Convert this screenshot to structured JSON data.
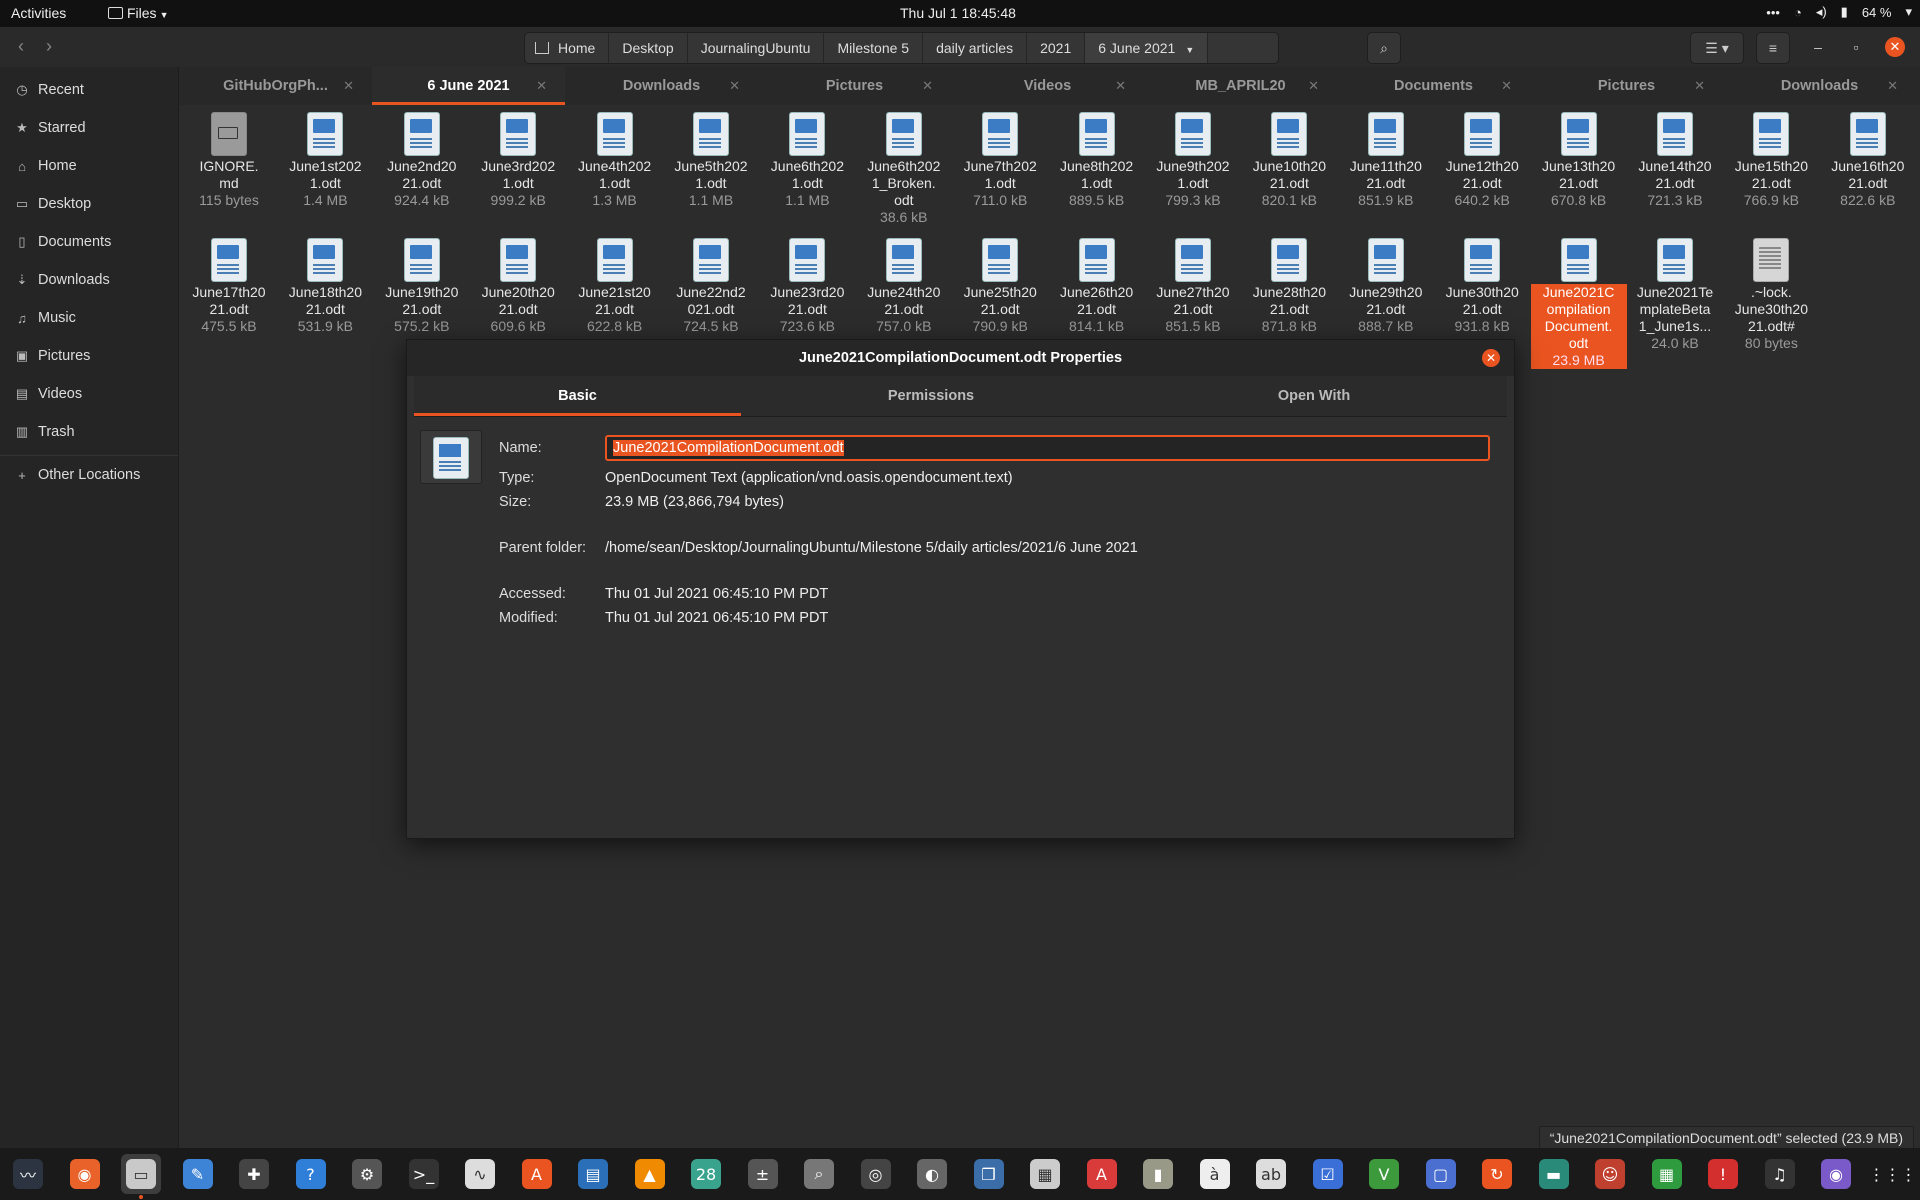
{
  "topbar": {
    "activities": "Activities",
    "app_menu": "Files",
    "clock": "Thu Jul 1  18:45:48",
    "battery": "64 %"
  },
  "pathbar": {
    "crumbs": [
      "Home",
      "Desktop",
      "JournalingUbuntu",
      "Milestone 5",
      "daily articles",
      "2021",
      "6 June 2021"
    ]
  },
  "sidebar": {
    "items": [
      {
        "label": "Recent",
        "icon": "clock-icon"
      },
      {
        "label": "Starred",
        "icon": "star-icon"
      },
      {
        "label": "Home",
        "icon": "home-icon"
      },
      {
        "label": "Desktop",
        "icon": "desktop-icon"
      },
      {
        "label": "Documents",
        "icon": "documents-icon"
      },
      {
        "label": "Downloads",
        "icon": "downloads-icon"
      },
      {
        "label": "Music",
        "icon": "music-icon"
      },
      {
        "label": "Pictures",
        "icon": "pictures-icon"
      },
      {
        "label": "Videos",
        "icon": "videos-icon"
      },
      {
        "label": "Trash",
        "icon": "trash-icon"
      }
    ],
    "other": "Other Locations"
  },
  "tabs": [
    "GitHubOrgPh...",
    "6 June 2021",
    "Downloads",
    "Pictures",
    "Videos",
    "MB_APRIL20",
    "Documents",
    "Pictures",
    "Downloads"
  ],
  "files": [
    {
      "name": "IGNORE.\nmd",
      "size": "115 bytes",
      "kind": "md"
    },
    {
      "name": "June1st202\n1.odt",
      "size": "1.4 MB"
    },
    {
      "name": "June2nd20\n21.odt",
      "size": "924.4 kB"
    },
    {
      "name": "June3rd202\n1.odt",
      "size": "999.2 kB"
    },
    {
      "name": "June4th202\n1.odt",
      "size": "1.3 MB"
    },
    {
      "name": "June5th202\n1.odt",
      "size": "1.1 MB"
    },
    {
      "name": "June6th202\n1.odt",
      "size": "1.1 MB"
    },
    {
      "name": "June6th202\n1_Broken.\nodt",
      "size": "38.6 kB"
    },
    {
      "name": "June7th202\n1.odt",
      "size": "711.0 kB"
    },
    {
      "name": "June8th202\n1.odt",
      "size": "889.5 kB"
    },
    {
      "name": "June9th202\n1.odt",
      "size": "799.3 kB"
    },
    {
      "name": "June10th20\n21.odt",
      "size": "820.1 kB"
    },
    {
      "name": "June11th20\n21.odt",
      "size": "851.9 kB"
    },
    {
      "name": "June12th20\n21.odt",
      "size": "640.2 kB"
    },
    {
      "name": "June13th20\n21.odt",
      "size": "670.8 kB"
    },
    {
      "name": "June14th20\n21.odt",
      "size": "721.3 kB"
    },
    {
      "name": "June15th20\n21.odt",
      "size": "766.9 kB"
    },
    {
      "name": "June16th20\n21.odt",
      "size": "822.6 kB"
    },
    {
      "name": "June17th20\n21.odt",
      "size": "475.5 kB"
    },
    {
      "name": "June18th20\n21.odt",
      "size": "531.9 kB"
    },
    {
      "name": "June19th20\n21.odt",
      "size": "575.2 kB"
    },
    {
      "name": "June20th20\n21.odt",
      "size": "609.6 kB"
    },
    {
      "name": "June21st20\n21.odt",
      "size": "622.8 kB"
    },
    {
      "name": "June22nd2\n021.odt",
      "size": "724.5 kB"
    },
    {
      "name": "June23rd20\n21.odt",
      "size": "723.6 kB"
    },
    {
      "name": "June24th20\n21.odt",
      "size": "757.0 kB"
    },
    {
      "name": "June25th20\n21.odt",
      "size": "790.9 kB"
    },
    {
      "name": "June26th20\n21.odt",
      "size": "814.1 kB"
    },
    {
      "name": "June27th20\n21.odt",
      "size": "851.5 kB"
    },
    {
      "name": "June28th20\n21.odt",
      "size": "871.8 kB"
    },
    {
      "name": "June29th20\n21.odt",
      "size": "888.7 kB"
    },
    {
      "name": "June30th20\n21.odt",
      "size": "931.8 kB"
    },
    {
      "name": "June2021C\nompilation\nDocument.\nodt",
      "size": "23.9 MB",
      "selected": true
    },
    {
      "name": "June2021Te\nmplateBeta\n1_June1s...",
      "size": "24.0 kB"
    },
    {
      "name": ".~lock.\nJune30th20\n21.odt#",
      "size": "80 bytes",
      "kind": "txt"
    }
  ],
  "dialog": {
    "title": "June2021CompilationDocument.odt Properties",
    "tabs": [
      "Basic",
      "Permissions",
      "Open With"
    ],
    "name_label": "Name:",
    "name_value": "June2021CompilationDocument.odt",
    "type_label": "Type:",
    "type_value": "OpenDocument Text (application/vnd.oasis.opendocument.text)",
    "size_label": "Size:",
    "size_value": "23.9 MB (23,866,794 bytes)",
    "parent_label": "Parent folder:",
    "parent_value": "/home/sean/Desktop/JournalingUbuntu/Milestone 5/daily articles/2021/6 June 2021",
    "accessed_label": "Accessed:",
    "accessed_value": "Thu 01 Jul 2021 06:45:10 PM PDT",
    "modified_label": "Modified:",
    "modified_value": "Thu 01 Jul 2021 06:45:10 PM PDT"
  },
  "status": "“June2021CompilationDocument.odt” selected  (23.9 MB)",
  "dock": [
    {
      "icon": "system-monitor-icon",
      "glyph": "〰",
      "bg": "#2b3440"
    },
    {
      "icon": "firefox-icon",
      "glyph": "◉",
      "bg": "#e8622a"
    },
    {
      "icon": "files-icon",
      "glyph": "▭",
      "bg": "#c9c9c9",
      "active": true
    },
    {
      "icon": "text-editor-icon",
      "glyph": "✎",
      "bg": "#3d83d6"
    },
    {
      "icon": "add-icon",
      "glyph": "✚",
      "bg": "#444"
    },
    {
      "icon": "help-icon",
      "glyph": "?",
      "bg": "#2f7fd8"
    },
    {
      "icon": "settings-icon",
      "glyph": "⚙",
      "bg": "#555"
    },
    {
      "icon": "terminal-icon",
      "glyph": ">_",
      "bg": "#333"
    },
    {
      "icon": "monitor-icon",
      "glyph": "∿",
      "bg": "#ddd"
    },
    {
      "icon": "software-icon",
      "glyph": "A",
      "bg": "#e95420"
    },
    {
      "icon": "writer-icon",
      "glyph": "▤",
      "bg": "#2a6fb8"
    },
    {
      "icon": "vlc-icon",
      "glyph": "▲",
      "bg": "#f08a00"
    },
    {
      "icon": "calendar-icon",
      "glyph": "28",
      "bg": "#3aa38e"
    },
    {
      "icon": "calculator-icon",
      "glyph": "±",
      "bg": "#555"
    },
    {
      "icon": "search-tool-icon",
      "glyph": "⌕",
      "bg": "#777"
    },
    {
      "icon": "backup-icon",
      "glyph": "◎",
      "bg": "#444"
    },
    {
      "icon": "disk-icon",
      "glyph": "◐",
      "bg": "#666"
    },
    {
      "icon": "book-icon",
      "glyph": "❒",
      "bg": "#3b6ea8"
    },
    {
      "icon": "document-viewer-icon",
      "glyph": "▦",
      "bg": "#ccc"
    },
    {
      "icon": "pdf-icon",
      "glyph": "A",
      "bg": "#d93b3b"
    },
    {
      "icon": "archive-icon",
      "glyph": "▮",
      "bg": "#998"
    },
    {
      "icon": "characters-icon",
      "glyph": "à",
      "bg": "#eee"
    },
    {
      "icon": "font-icon",
      "glyph": "ab",
      "bg": "#ddd"
    },
    {
      "icon": "tasks-icon",
      "glyph": "☑",
      "bg": "#3a6fd8"
    },
    {
      "icon": "vim-icon",
      "glyph": "V",
      "bg": "#3c9a3c"
    },
    {
      "icon": "screen-icon",
      "glyph": "▢",
      "bg": "#4a6fd0"
    },
    {
      "icon": "update-icon",
      "glyph": "↻",
      "bg": "#e95420"
    },
    {
      "icon": "education-icon",
      "glyph": "▬",
      "bg": "#2a8a7a"
    },
    {
      "icon": "game-icon",
      "glyph": "☺",
      "bg": "#c04030"
    },
    {
      "icon": "calc-sheet-icon",
      "glyph": "▦",
      "bg": "#2e9b3e"
    },
    {
      "icon": "alert-icon",
      "glyph": "!",
      "bg": "#d32f2f"
    },
    {
      "icon": "music-player-icon",
      "glyph": "♫",
      "bg": "#333"
    },
    {
      "icon": "camera-icon",
      "glyph": "◉",
      "bg": "#7a5ac8"
    },
    {
      "icon": "app-grid-icon",
      "glyph": "⋮⋮⋮",
      "bg": "transparent"
    }
  ]
}
